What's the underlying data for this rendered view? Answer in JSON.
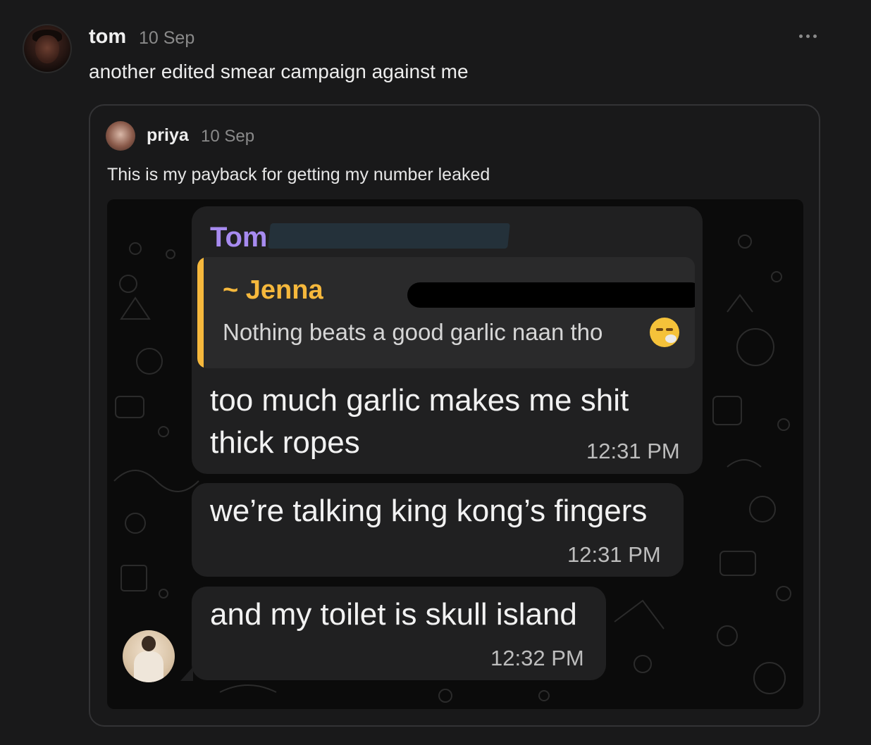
{
  "post": {
    "author": "tom",
    "date": "10 Sep",
    "text": "another edited smear campaign against me"
  },
  "quoted_post": {
    "author": "priya",
    "date": "10 Sep",
    "text": "This is my payback for getting my number leaked"
  },
  "chat": {
    "sender_name": "Tom",
    "reply": {
      "name": "~ Jenna",
      "text": "Nothing beats a good garlic naan tho"
    },
    "messages": [
      {
        "line1": "too much garlic makes me shit",
        "line2": "thick ropes",
        "time": "12:31 PM"
      },
      {
        "line1": "we’re talking king kong’s fingers",
        "line2": "",
        "time": "12:31 PM"
      },
      {
        "line1": "and my toilet is skull island",
        "line2": "",
        "time": "12:32 PM"
      }
    ]
  },
  "colors": {
    "background": "#19191a",
    "sender_accent": "#a78bf0",
    "reply_accent": "#f6b83c",
    "bubble": "#202021"
  },
  "icons": {
    "more": "more-horizontal-icon",
    "emoji": "face-exhaling-emoji-icon"
  }
}
